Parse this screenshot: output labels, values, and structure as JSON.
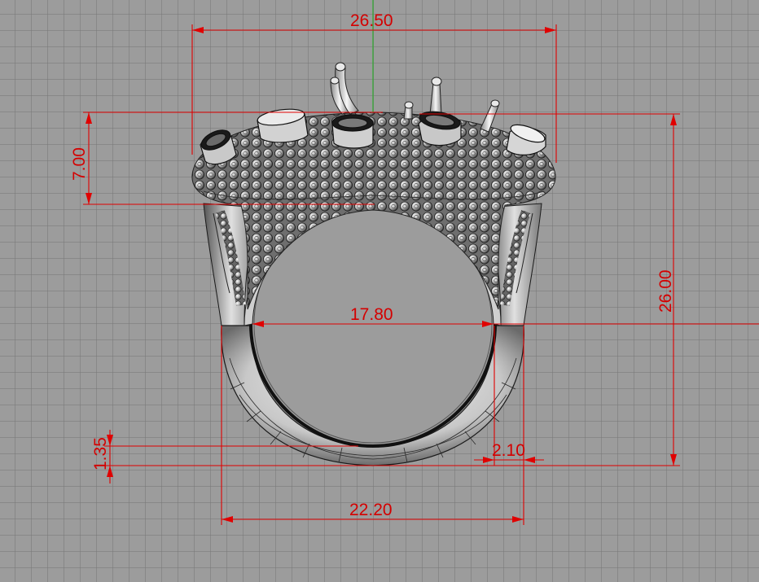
{
  "viewport": {
    "view": "Front",
    "background_color": "#9c9c9c",
    "grid_color": "#7a7a7a",
    "dimension_color": "#e00000",
    "y_axis_color": "#2fa82f"
  },
  "model": {
    "object": "ring",
    "icon": "ring-model-icon"
  },
  "dimensions": {
    "top_width": "26.50",
    "head_height": "7.00",
    "total_height": "26.00",
    "inner_diameter": "17.80",
    "bottom_thickness": "1.35",
    "side_thickness": "2.10",
    "outer_width": "22.20"
  }
}
